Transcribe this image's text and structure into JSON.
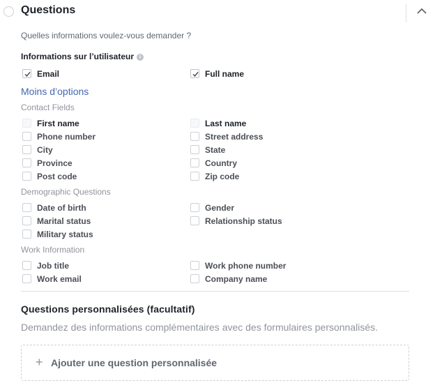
{
  "header": {
    "title": "Questions"
  },
  "intro": {
    "subtitle": "Quelles informations voulez-vous demander ?",
    "user_info_label": "Informations sur l’utilisateur",
    "info_icon_glyph": "i"
  },
  "user_info": {
    "email": {
      "label": "Email",
      "checked": true
    },
    "full_name": {
      "label": "Full name",
      "checked": true
    }
  },
  "less_options_link": "Moins d’options",
  "contact_fields": {
    "heading": "Contact Fields",
    "first_name": "First name",
    "last_name": "Last name",
    "phone_number": "Phone number",
    "street_address": "Street address",
    "city": "City",
    "state": "State",
    "province": "Province",
    "country": "Country",
    "post_code": "Post code",
    "zip_code": "Zip code"
  },
  "demographic": {
    "heading": "Demographic Questions",
    "date_of_birth": "Date of birth",
    "gender": "Gender",
    "marital_status": "Marital status",
    "relationship_status": "Relationship status",
    "military_status": "Military status"
  },
  "work": {
    "heading": "Work Information",
    "job_title": "Job title",
    "work_phone_number": "Work phone number",
    "work_email": "Work email",
    "company_name": "Company name"
  },
  "custom_questions": {
    "title": "Questions personnalisées (facultatif)",
    "description": "Demandez des informations complémentaires avec des formulaires personnalisés.",
    "add_plus": "+",
    "add_label": "Ajouter une question personnalisée"
  },
  "colors": {
    "link": "#4267b2",
    "muted": "#90949c",
    "text": "#1d2129"
  }
}
